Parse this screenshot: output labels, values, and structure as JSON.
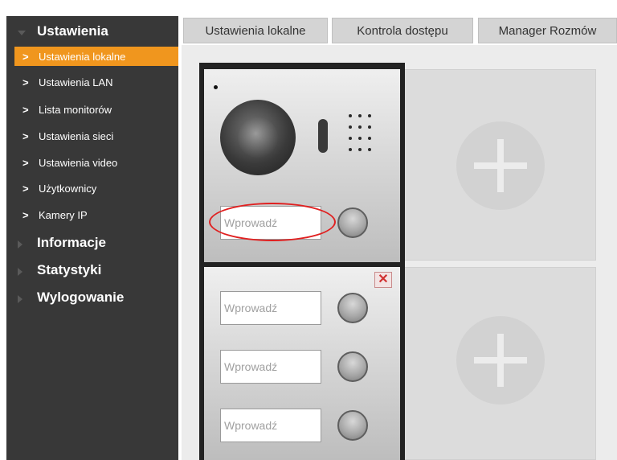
{
  "sidebar": {
    "sections": [
      {
        "label": "Ustawienia",
        "expanded": true
      },
      {
        "label": "Informacje",
        "expanded": false
      },
      {
        "label": "Statystyki",
        "expanded": false
      },
      {
        "label": "Wylogowanie",
        "expanded": false
      }
    ],
    "items": [
      {
        "label": "Ustawienia lokalne",
        "active": true
      },
      {
        "label": "Ustawienia LAN",
        "active": false
      },
      {
        "label": "Lista monitorów",
        "active": false
      },
      {
        "label": "Ustawienia sieci",
        "active": false
      },
      {
        "label": "Ustawienia video",
        "active": false
      },
      {
        "label": "Użytkownicy",
        "active": false
      },
      {
        "label": "Kamery IP",
        "active": false
      }
    ],
    "chevron": ">"
  },
  "tabs": [
    {
      "label": "Ustawienia lokalne"
    },
    {
      "label": "Kontrola dostępu"
    },
    {
      "label": "Manager Rozmów"
    }
  ],
  "panel": {
    "input_placeholder": "Wprowadź",
    "delete_symbol": "✕"
  },
  "colors": {
    "sidebar_bg": "#383838",
    "active_item_bg": "#f0961e",
    "highlight_ring": "#e02020"
  },
  "icons": [
    "chevron-right-icon",
    "triangle-down-icon",
    "triangle-right-icon",
    "plus-icon",
    "close-icon",
    "camera-icon",
    "call-button-icon"
  ]
}
